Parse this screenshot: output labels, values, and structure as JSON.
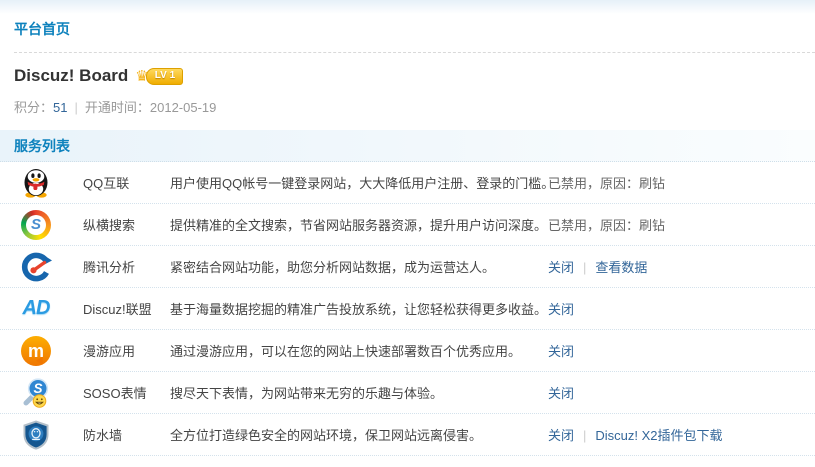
{
  "breadcrumb": "平台首页",
  "site": {
    "title": "Discuz! Board",
    "level_badge": "LV 1",
    "credits_label": "积分：",
    "credits_value": "51",
    "separator": "|",
    "opened_label": "开通时间：",
    "opened_value": "2012-05-19"
  },
  "section": {
    "title": "服务列表"
  },
  "link_separator": "|",
  "icon_glyphs": {
    "crown": "♛",
    "soso_search_letter": "S",
    "ad_letters": "AD",
    "manyou_letter": "m",
    "soso_emoticon_letter": "S"
  },
  "services": [
    {
      "icon": "qq-penguin-icon",
      "name": "QQ互联",
      "description": "用户使用QQ帐号一键登录网站，大大降低用户注册、登录的门槛。",
      "status_text": "已禁用，原因：刷钻",
      "links": []
    },
    {
      "icon": "soso-search-icon",
      "name": "纵横搜索",
      "description": "提供精准的全文搜索，节省网站服务器资源，提升用户访问深度。",
      "status_text": "已禁用，原因：刷钻",
      "links": []
    },
    {
      "icon": "tencent-analytics-icon",
      "name": "腾讯分析",
      "description": "紧密结合网站功能，助您分析网站数据，成为运营达人。",
      "status_text": "",
      "links": [
        "关闭",
        "查看数据"
      ]
    },
    {
      "icon": "ad-union-icon",
      "name": "Discuz!联盟",
      "description": "基于海量数据挖掘的精准广告投放系统，让您轻松获得更多收益。",
      "status_text": "",
      "links": [
        "关闭"
      ]
    },
    {
      "icon": "manyou-app-icon",
      "name": "漫游应用",
      "description": "通过漫游应用，可以在您的网站上快速部署数百个优秀应用。",
      "status_text": "",
      "links": [
        "关闭"
      ]
    },
    {
      "icon": "soso-emoticon-icon",
      "name": "SOSO表情",
      "description": "搜尽天下表情，为网站带来无穷的乐趣与体验。",
      "status_text": "",
      "links": [
        "关闭"
      ]
    },
    {
      "icon": "security-shield-icon",
      "name": "防水墙",
      "description": "全方位打造绿色安全的网站环境，保卫网站远离侵害。",
      "status_text": "",
      "links": [
        "关闭",
        "Discuz! X2插件包下载"
      ]
    }
  ],
  "colors": {
    "heading_blue": "#0e82bd",
    "link_blue": "#336699",
    "meta_gray": "#999999",
    "row_text": "#444444",
    "status_gray": "#666666",
    "section_bg": "#e9f3fa",
    "badge_gold": "#f0ad00"
  }
}
